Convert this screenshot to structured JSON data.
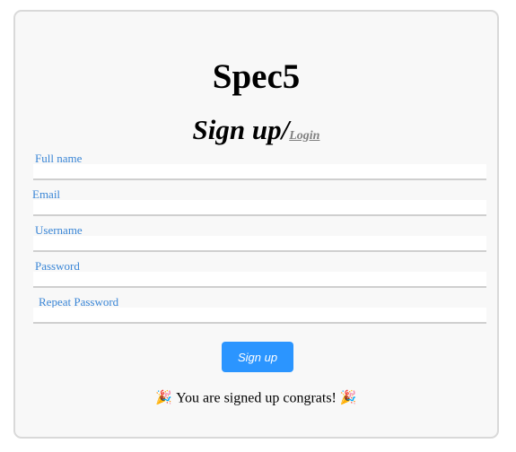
{
  "brand": "Spec5",
  "heading": {
    "title": "Sign up/",
    "login_link": "Login"
  },
  "fields": {
    "full_name": {
      "label": "Full name",
      "value": ""
    },
    "email": {
      "label": "Email",
      "value": ""
    },
    "username": {
      "label": "Username",
      "value": ""
    },
    "password": {
      "label": "Password",
      "value": ""
    },
    "repeat_password": {
      "label": "Repeat Password",
      "value": ""
    }
  },
  "submit_button": "Sign up",
  "message": {
    "text": "You are signed up congrats!",
    "icon": "party-popper-icon"
  },
  "colors": {
    "accent": "#2b95ff",
    "label": "#3a86d6",
    "link": "#808080",
    "card_background": "#f8f8f8"
  }
}
